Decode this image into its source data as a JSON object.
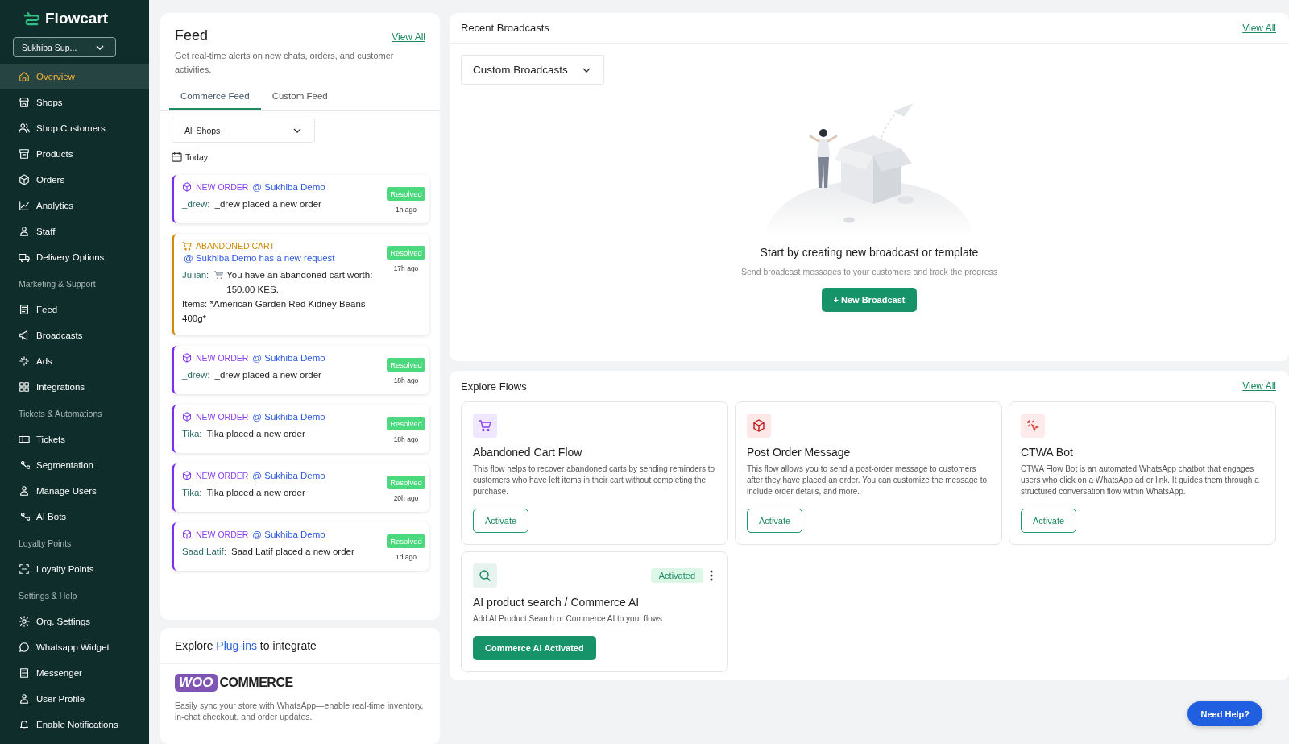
{
  "sidebar": {
    "logo": "Flowcart",
    "org_select": "Sukhiba Sup...",
    "items": [
      {
        "kind": "item",
        "label": "Overview",
        "selected": true
      },
      {
        "kind": "item",
        "label": "Shops",
        "selected": false
      },
      {
        "kind": "item",
        "label": "Shop Customers",
        "selected": false
      },
      {
        "kind": "item",
        "label": "Products",
        "selected": false
      },
      {
        "kind": "item",
        "label": "Orders",
        "selected": false
      },
      {
        "kind": "item",
        "label": "Analytics",
        "selected": false
      },
      {
        "kind": "item",
        "label": "Staff",
        "selected": false
      },
      {
        "kind": "item",
        "label": "Delivery Options",
        "selected": false
      },
      {
        "kind": "section",
        "label": "Marketing & Support"
      },
      {
        "kind": "item",
        "label": "Feed",
        "selected": false
      },
      {
        "kind": "item",
        "label": "Broadcasts",
        "selected": false
      },
      {
        "kind": "item",
        "label": "Ads",
        "selected": false
      },
      {
        "kind": "item",
        "label": "Integrations",
        "selected": false
      },
      {
        "kind": "section",
        "label": "Tickets & Automations"
      },
      {
        "kind": "item",
        "label": "Tickets",
        "selected": false
      },
      {
        "kind": "item",
        "label": "Segmentation",
        "selected": false
      },
      {
        "kind": "item",
        "label": "Manage Users",
        "selected": false
      },
      {
        "kind": "item",
        "label": "AI Bots",
        "selected": false
      },
      {
        "kind": "section",
        "label": "Loyalty Points"
      },
      {
        "kind": "item",
        "label": "Loyalty Points",
        "selected": false
      },
      {
        "kind": "section",
        "label": "Settings & Help"
      },
      {
        "kind": "item",
        "label": "Org. Settings",
        "selected": false
      },
      {
        "kind": "item",
        "label": "Whatsapp Widget",
        "selected": false
      },
      {
        "kind": "item",
        "label": "Messenger",
        "selected": false
      },
      {
        "kind": "item",
        "label": "User Profile",
        "selected": false
      },
      {
        "kind": "item",
        "label": "Enable Notifications",
        "selected": false
      }
    ]
  },
  "feed": {
    "title": "Feed",
    "view_all": "View All",
    "description": "Get real-time alerts on new chats, orders, and customer activities.",
    "tabs": [
      {
        "label": "Commerce Feed",
        "selected": true
      },
      {
        "label": "Custom Feed",
        "selected": false
      }
    ],
    "shop_filter": "All Shops",
    "date_label": "Today",
    "items": [
      {
        "kind": "order",
        "tag": "NEW ORDER",
        "mention": "@ Sukhiba Demo",
        "author": "_drew:",
        "message": "_drew placed a new order",
        "status": "Resolved",
        "time": "1h ago"
      },
      {
        "kind": "cart",
        "tag": "ABANDONED CART",
        "mention": "@ Sukhiba Demo has a new request",
        "author": "Julian:",
        "message": "You have an abandoned cart worth: 150.00 KES.",
        "extra": "Items: *American Garden Red Kidney Beans 400g*",
        "status": "Resolved",
        "time": "17h ago"
      },
      {
        "kind": "order",
        "tag": "NEW ORDER",
        "mention": "@ Sukhiba Demo",
        "author": "_drew:",
        "message": "_drew placed a new order",
        "status": "Resolved",
        "time": "18h ago"
      },
      {
        "kind": "order",
        "tag": "NEW ORDER",
        "mention": "@ Sukhiba Demo",
        "author": "Tika:",
        "message": "Tika placed a new order",
        "status": "Resolved",
        "time": "18h ago"
      },
      {
        "kind": "order",
        "tag": "NEW ORDER",
        "mention": "@ Sukhiba Demo",
        "author": "Tika:",
        "message": "Tika placed a new order",
        "status": "Resolved",
        "time": "20h ago"
      },
      {
        "kind": "order",
        "tag": "NEW ORDER",
        "mention": "@ Sukhiba Demo",
        "author": "Saad Latif:",
        "message": "Saad Latif placed a new order",
        "status": "Resolved",
        "time": "1d ago"
      }
    ]
  },
  "plugins": {
    "title_start": "Explore",
    "title_link": "Plug-ins",
    "title_end": "to integrate",
    "brand_badge": "WOO",
    "brand_word": "COMMERCE",
    "description": "Easily sync your store with WhatsApp—enable real-time inventory, in-chat checkout, and order updates."
  },
  "broadcasts": {
    "title": "Recent Broadcasts",
    "view_all": "View All",
    "filter": "Custom Broadcasts",
    "empty_title": "Start by creating new broadcast or template",
    "empty_text": "Send broadcast messages to your customers and track the progress",
    "new_button": "+ New Broadcast"
  },
  "flows": {
    "title": "Explore Flows",
    "view_all": "View All",
    "items": [
      {
        "kind": "cart",
        "title": "Abandoned Cart Flow",
        "description": "This flow helps to recover abandoned carts by sending reminders to customers who have left items in their cart without completing the purchase.",
        "activated": false,
        "button": "Activate"
      },
      {
        "kind": "box",
        "title": "Post Order Message",
        "description": "This flow allows you to send a post-order message to customers after they have placed an order. You can customize the message to include order details, and more.",
        "activated": false,
        "button": "Activate"
      },
      {
        "kind": "click",
        "title": "CTWA Bot",
        "description": "CTWA Flow Bot is an automated WhatsApp chatbot that engages users who click on a WhatsApp ad or link. It guides them through a structured conversation flow within WhatsApp.",
        "activated": false,
        "button": "Activate"
      },
      {
        "kind": "search",
        "title": "AI product search / Commerce AI",
        "description": "Add AI Product Search or Commerce AI to your flows",
        "activated": true,
        "badge": "Activated",
        "button": "Commerce AI Activated"
      }
    ]
  },
  "help_button": "Need Help?"
}
